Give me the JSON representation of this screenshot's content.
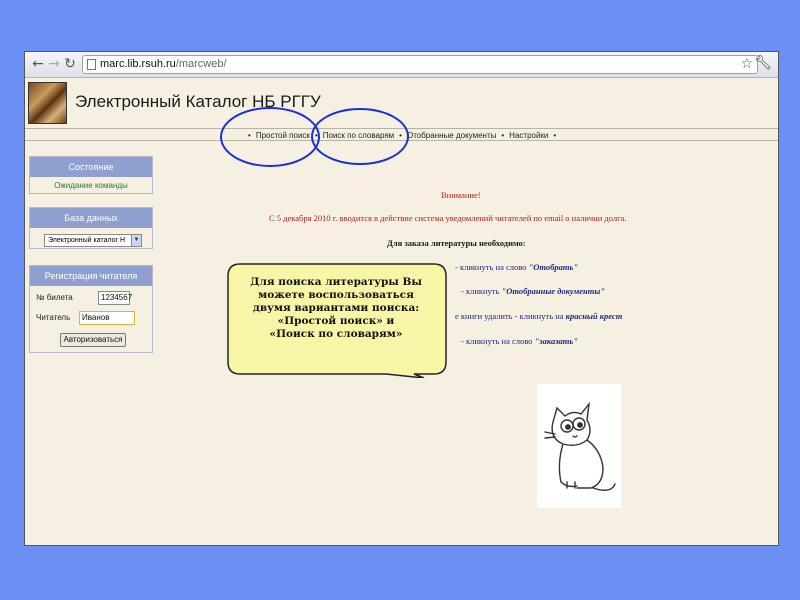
{
  "browser": {
    "url_host": "marc.lib.rsuh.ru",
    "url_path": "/marcweb/",
    "back_icon": "back-arrow-icon",
    "forward_icon": "forward-arrow-icon",
    "reload_icon": "reload-icon"
  },
  "header": {
    "title": "Электронный Каталог НБ РГГУ"
  },
  "menu": {
    "items": [
      "Простой поиск",
      "Поиск по словарям",
      "Отобранные документы",
      "Настройки"
    ],
    "bullet": "•"
  },
  "sidebar": {
    "state": {
      "title": "Состояние",
      "value": "Ожидание команды"
    },
    "database": {
      "title": "База данных",
      "selected": "Электронный каталог Н"
    },
    "registration": {
      "title": "Регистрация читателя",
      "ticket_label": "№ билета",
      "ticket_value": "1234567",
      "reader_label": "Читатель",
      "reader_value": "Иванов",
      "login_button": "Авторизоваться"
    }
  },
  "main": {
    "attention": "Внимание!",
    "notice": "С 5 декабря 2010 г. вводится в действие система уведомлений читателей по email о наличии долга.",
    "need": "Для заказа литературы необходимо:",
    "steps": [
      {
        "text": "- кликнуть на слово ",
        "em": "\"Отобрать\""
      },
      {
        "text": "- кликнуть ",
        "em": "\"Отобранные документы\""
      },
      {
        "text": "е книги удалить - кликнуть на ",
        "em": "красный крест"
      },
      {
        "text": "- кликнуть на слово ",
        "em": "\"заказать\""
      }
    ]
  },
  "callout": {
    "lines": [
      "Для поиска литературы Вы",
      "можете воспользоваться",
      "двумя вариантами поиска:",
      "«Простой поиск» и",
      "«Поиск по словарям»"
    ]
  },
  "colors": {
    "slide_bg": "#6b8ff4",
    "page_bg": "#f6f0e2",
    "panel_header": "#8fa0d0",
    "annotation_circle": "#1a2fd8",
    "callout_fill": "#f8f6a6",
    "notice_red": "#b12020"
  }
}
